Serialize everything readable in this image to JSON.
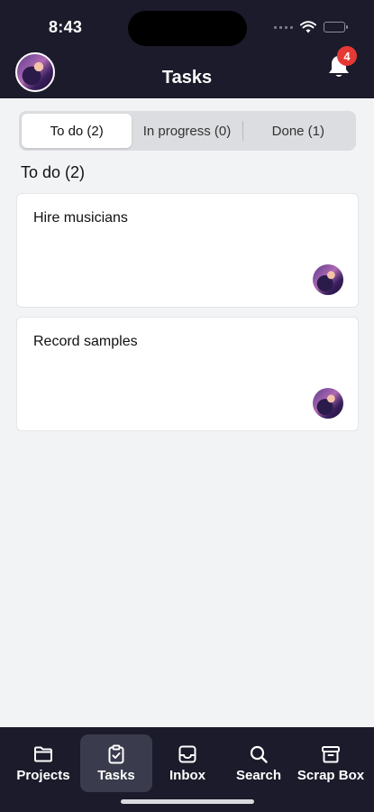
{
  "status_bar": {
    "time": "8:43"
  },
  "header": {
    "title": "Tasks",
    "notification_count": "4"
  },
  "segments": [
    {
      "label": "To do (2)",
      "active": true
    },
    {
      "label": "In progress (0)",
      "active": false
    },
    {
      "label": "Done (1)",
      "active": false
    }
  ],
  "section": {
    "title": "To do (2)"
  },
  "tasks": [
    {
      "title": "Hire musicians"
    },
    {
      "title": "Record samples"
    }
  ],
  "tabbar": {
    "items": [
      {
        "label": "Projects",
        "icon": "folder-icon",
        "active": false
      },
      {
        "label": "Tasks",
        "icon": "clipboard-check-icon",
        "active": true
      },
      {
        "label": "Inbox",
        "icon": "inbox-icon",
        "active": false
      },
      {
        "label": "Search",
        "icon": "search-icon",
        "active": false
      },
      {
        "label": "Scrap Box",
        "icon": "archive-box-icon",
        "active": false
      }
    ]
  },
  "colors": {
    "header_bg": "#1b1b2b",
    "page_bg": "#f2f3f5",
    "badge": "#e53935",
    "active_tab_bg": "#3a3b4c"
  }
}
